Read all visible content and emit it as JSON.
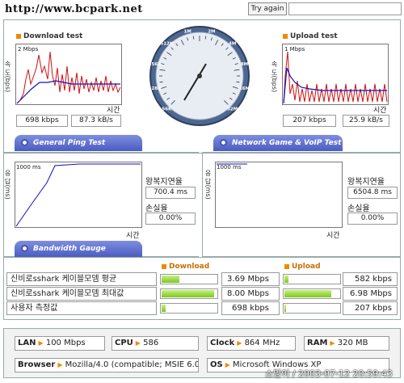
{
  "header": {
    "url": "http://www.bcpark.net",
    "try_again": "Try again",
    "input_value": ""
  },
  "download": {
    "title": "Download test",
    "max_label": "2 Mbps",
    "y_axis": "속 도(bps)",
    "x_axis": "시간",
    "kbps": "698 kbps",
    "kBs": "87.3 kB/s"
  },
  "upload": {
    "title": "Upload test",
    "max_label": "1 Mbps",
    "y_axis": "속 도(bps)",
    "x_axis": "시간",
    "kbps": "207 kbps",
    "kBs": "25.9 kB/s"
  },
  "tabs": {
    "ping": "General Ping Test",
    "game": "Network Game & VoIP Test",
    "gauge": "Bandwidth Gauge"
  },
  "ping_left": {
    "y_axis": "응 답(ms)",
    "max_label": "1000 ms",
    "x_axis": "시간",
    "rtt_label": "왕복지연율",
    "rtt_value": "700.4 ms",
    "loss_label": "손실율",
    "loss_value": "0.00%"
  },
  "ping_right": {
    "y_axis": "응 답(ms)",
    "max_label": "1000 ms",
    "x_axis": "시간",
    "rtt_label": "왕복지연율",
    "rtt_value": "6504.8 ms",
    "loss_label": "손실율",
    "loss_value": "0.00%"
  },
  "gauge_table": {
    "download_header": "Download",
    "upload_header": "Upload",
    "rows": [
      {
        "label": "신비로sshark 케이블모뎀 평균",
        "down_value": "3.69 Mbps",
        "down_fill": 0.32,
        "up_value": "582 kbps",
        "up_fill": 0.07
      },
      {
        "label": "신비로sshark 케이블모뎀 최대값",
        "down_value": "8.00 Mbps",
        "down_fill": 0.95,
        "up_value": "6.98 Mbps",
        "up_fill": 0.85
      },
      {
        "label": "사용자 측정값",
        "down_value": "698 kbps",
        "down_fill": 0.07,
        "up_value": "207 kbps",
        "up_fill": 0.03
      }
    ]
  },
  "sysinfo": {
    "lan_label": "LAN",
    "lan_value": "100 Mbps",
    "cpu_label": "CPU",
    "cpu_value": "586",
    "clock_label": "Clock",
    "clock_value": "864 MHz",
    "ram_label": "RAM",
    "ram_value": "320 MB",
    "browser_label": "Browser",
    "browser_value": "Mozilla/4.0 (compatible; MSIE 6.0",
    "os_label": "OS",
    "os_value": "Microsoft Windows XP"
  },
  "watermark": "소망이 / 2003-07-12 20:59:43",
  "colors": {
    "accent_orange": "#f08a00",
    "tab_blue": "#5060c8",
    "plot_red": "#d01010",
    "plot_blue": "#1010c0",
    "gauge_green": "#7cc820"
  },
  "gauge_dial": {
    "labels": [
      "56K",
      "128K",
      "256K",
      "512K",
      "1M",
      "2M",
      "4M",
      "8M",
      "16M",
      "32M"
    ]
  }
}
